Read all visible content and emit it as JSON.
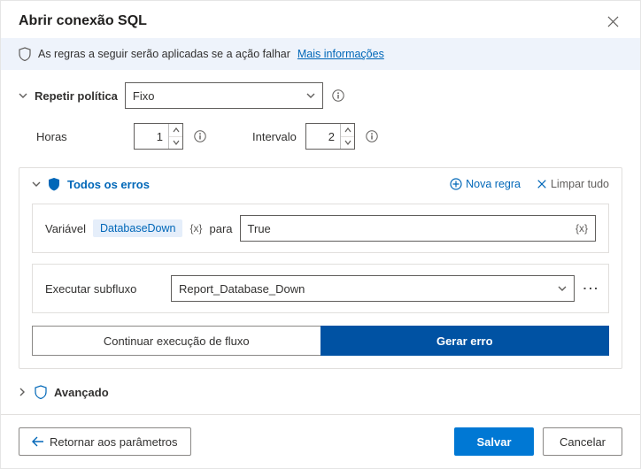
{
  "title": "Abrir conexão SQL",
  "info": {
    "text": "As regras a seguir serão aplicadas se a ação falhar",
    "link": "Mais informações"
  },
  "policy": {
    "label": "Repetir política",
    "value": "Fixo",
    "hours_label": "Horas",
    "hours_value": "1",
    "interval_label": "Intervalo",
    "interval_value": "2"
  },
  "errors": {
    "title": "Todos os erros",
    "new_rule": "Nova regra",
    "clear_all": "Limpar tudo",
    "rule": {
      "var_label": "Variável",
      "var_name": "DatabaseDown",
      "para_label": "para",
      "value": "True"
    },
    "subflow": {
      "label": "Executar subfluxo",
      "value": "Report_Database_Down"
    },
    "continue_label": "Continuar execução de fluxo",
    "throw_label": "Gerar erro"
  },
  "advanced_label": "Avançado",
  "footer": {
    "back": "Retornar aos parâmetros",
    "save": "Salvar",
    "cancel": "Cancelar"
  }
}
